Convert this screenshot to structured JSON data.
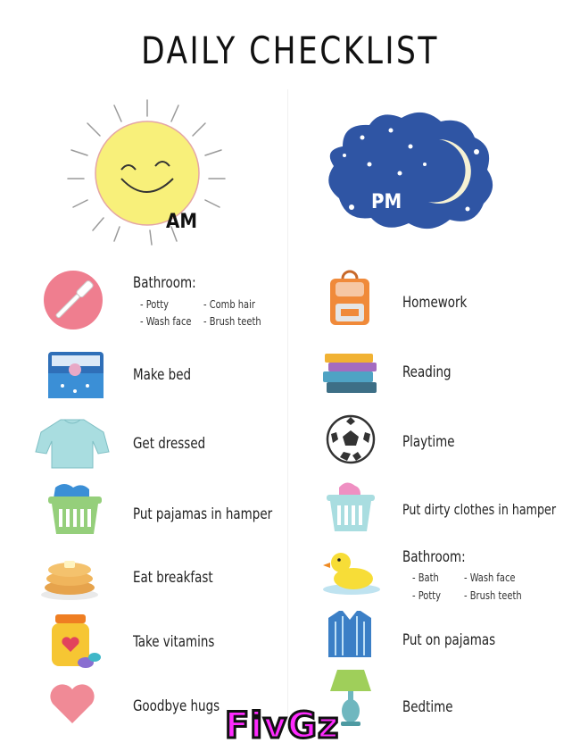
{
  "title": "DAILY CHECKLIST",
  "am": {
    "label": "AM"
  },
  "pm": {
    "label": "PM"
  },
  "am_items": [
    {
      "label": "Bathroom:",
      "subs": [
        "- Potty",
        "- Comb hair",
        "- Wash face",
        "- Brush teeth"
      ],
      "icon": "toothbrush-icon"
    },
    {
      "label": "Make bed",
      "icon": "bed-icon"
    },
    {
      "label": "Get dressed",
      "icon": "sweater-icon"
    },
    {
      "label": "Put pajamas in hamper",
      "icon": "hamper-icon"
    },
    {
      "label": "Eat breakfast",
      "icon": "pancakes-icon"
    },
    {
      "label": "Take vitamins",
      "icon": "vitamins-icon"
    },
    {
      "label": "Goodbye hugs",
      "icon": "heart-icon"
    }
  ],
  "pm_items": [
    {
      "label": "Homework",
      "icon": "backpack-icon"
    },
    {
      "label": "Reading",
      "icon": "books-icon"
    },
    {
      "label": "Playtime",
      "icon": "soccer-ball-icon"
    },
    {
      "label": "Put dirty clothes in hamper",
      "icon": "hamper-icon"
    },
    {
      "label": "Bathroom:",
      "subs": [
        "- Bath",
        "- Wash face",
        "- Potty",
        "- Brush teeth"
      ],
      "icon": "duck-icon"
    },
    {
      "label": "Put on pajamas",
      "icon": "pajamas-icon"
    },
    {
      "label": "Bedtime",
      "icon": "lamp-icon"
    }
  ],
  "watermark": "FivGz",
  "colors": {
    "sun": "#f8f07a",
    "cloud": "#2f55a4",
    "moon": "#f5f1d4",
    "pink": "#ef7e8f",
    "blue": "#3b8fd6",
    "teal": "#a9dde0",
    "green": "#95cf7b"
  }
}
